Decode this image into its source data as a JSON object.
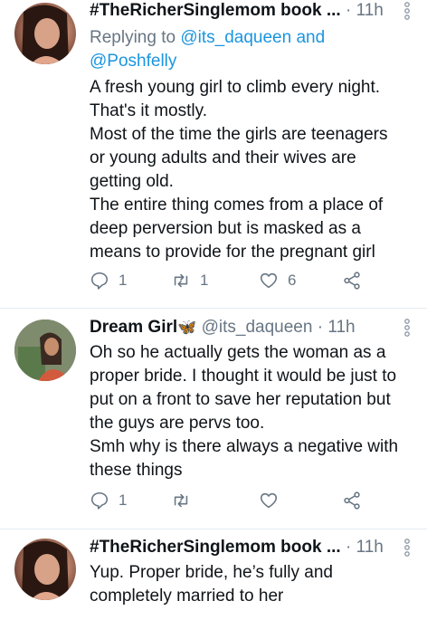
{
  "tweets": [
    {
      "name": "#TheRicherSinglemom book ...",
      "time": "11h",
      "reply_prefix": "Replying to ",
      "reply_mention1": "@its_daqueen",
      "reply_and": " and",
      "reply_mention2": "@Poshfelly",
      "lines": [
        "A fresh young girl to climb every night.",
        "That's it mostly.",
        "Most of the time the girls are teenagers",
        "or young adults and their wives are",
        "getting old.",
        "The entire thing comes from a place of",
        "deep perversion but is masked as a",
        "means to provide for the pregnant girl"
      ],
      "replies": "1",
      "retweets": "1",
      "likes": "6"
    },
    {
      "name": "Dream Girl",
      "handle": "@its_daqueen",
      "time": "11h",
      "lines": [
        "Oh so he actually gets the woman as a",
        "proper bride. I thought it would be just to",
        "put on a front to save her reputation but",
        "the guys are pervs too.",
        "Smh why is there always a negative with",
        "these things"
      ],
      "replies": "1"
    },
    {
      "name": "#TheRicherSinglemom book ...",
      "time": "11h",
      "lines": [
        "Yup. Proper bride, he’s fully and",
        "completely married to her"
      ]
    }
  ],
  "separator_dot": "·",
  "emoji": "🦋",
  "icons": {
    "reply": "reply-icon",
    "retweet": "retweet-icon",
    "like": "heart-icon",
    "share": "share-icon",
    "more": "more-vertical-icon"
  },
  "colors": {
    "text": "#0f1419",
    "secondary": "#687684",
    "link": "#1b95e0",
    "divider": "#e6ecf0"
  }
}
